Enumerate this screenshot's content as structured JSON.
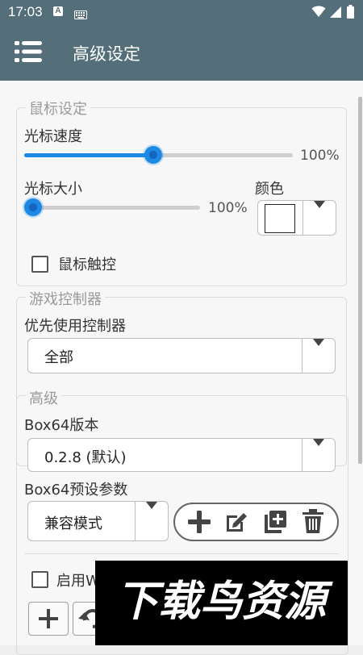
{
  "status_bar": {
    "time": "17:03",
    "a_badge": "A"
  },
  "app_bar": {
    "title": "高级设定",
    "menu_icon": "hamburger-menu-icon"
  },
  "mouse_settings": {
    "legend": "鼠标设定",
    "cursor_speed": {
      "label": "光标速度",
      "value_text": "100%",
      "level": 0.48
    },
    "cursor_size": {
      "label": "光标大小",
      "value_text": "100%",
      "level": 0.0
    },
    "color": {
      "label": "颜色",
      "value": "#ffffff"
    },
    "mouse_touch": {
      "label": "鼠标触控",
      "checked": false
    }
  },
  "game_controller": {
    "legend": "游戏控制器",
    "preferred_label": "优先使用控制器",
    "preferred_value": "全部"
  },
  "advanced": {
    "legend": "高级",
    "box64_version_label": "Box64版本",
    "box64_version_value": "0.2.8 (默认)",
    "box64_preset_label": "Box64预设参数",
    "box64_preset_value": "兼容模式",
    "preset_tools": [
      "add-icon",
      "edit-icon",
      "duplicate-icon",
      "delete-icon"
    ],
    "enable_label": "启用W",
    "enable_checked": false
  },
  "watermark": {
    "text": "下载鸟资源"
  },
  "colors": {
    "primary": "#546e7a",
    "accent": "#1e88e5",
    "background": "#f7f7f7"
  }
}
